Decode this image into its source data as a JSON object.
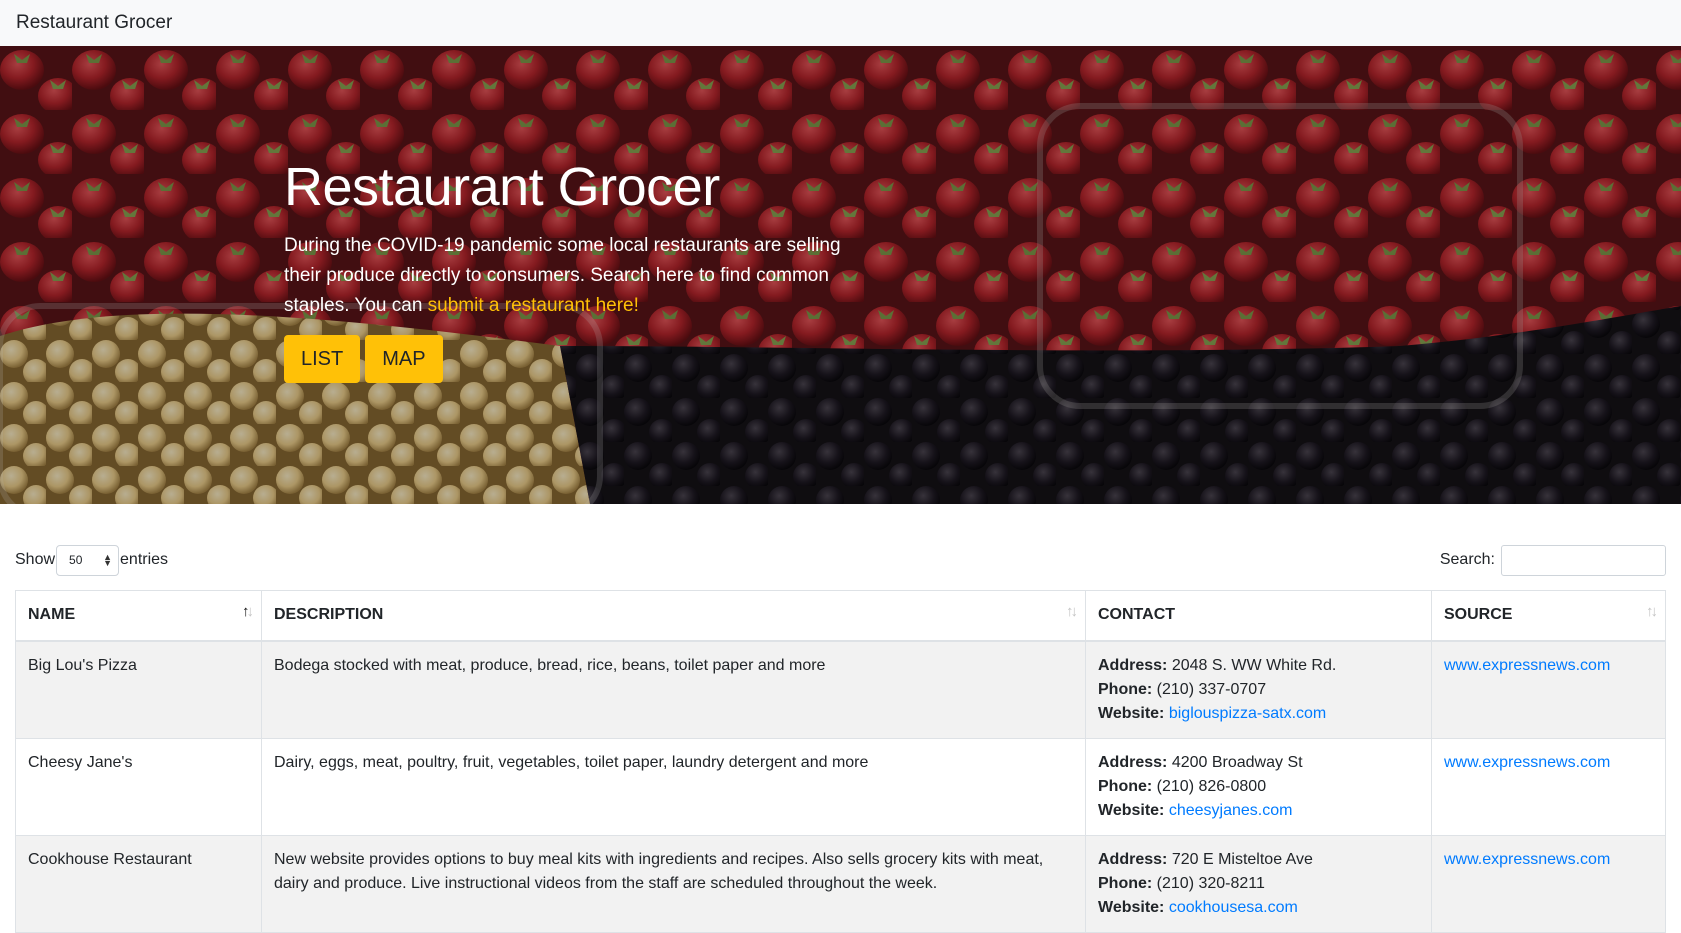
{
  "navbar": {
    "brand": "Restaurant Grocer"
  },
  "hero": {
    "title": "Restaurant Grocer",
    "text_before_link": "During the COVID-19 pandemic some local restaurants are selling their produce directly to consumers. Search here to find common staples. You can ",
    "link_text": "submit a restaurant here!",
    "buttons": {
      "list": "LIST",
      "map": "MAP"
    },
    "accent_color": "#ffc107"
  },
  "controls": {
    "show_label": "Show",
    "entries_label": "entries",
    "length_value": "50",
    "search_label": "Search:",
    "search_value": ""
  },
  "table": {
    "columns": [
      "NAME",
      "DESCRIPTION",
      "CONTACT",
      "SOURCE"
    ],
    "labels": {
      "address": "Address:",
      "phone": "Phone:",
      "website": "Website:"
    },
    "rows": [
      {
        "name": "Big Lou's Pizza",
        "description": "Bodega stocked with meat, produce, bread, rice, beans, toilet paper and more",
        "address": "2048 S. WW White Rd.",
        "phone": "(210) 337-0707",
        "website": "biglouspizza-satx.com",
        "source": "www.expressnews.com"
      },
      {
        "name": "Cheesy Jane's",
        "description": "Dairy, eggs, meat, poultry, fruit, vegetables, toilet paper, laundry detergent and more",
        "address": "4200 Broadway St",
        "phone": "(210) 826-0800",
        "website": "cheesyjanes.com",
        "source": "www.expressnews.com"
      },
      {
        "name": "Cookhouse Restaurant",
        "description": "New website provides options to buy meal kits with ingredients and recipes. Also sells grocery kits with meat, dairy and produce. Live instructional videos from the staff are scheduled throughout the week.",
        "address": "720 E Misteltoe Ave",
        "phone": "(210) 320-8211",
        "website": "cookhousesa.com",
        "source": "www.expressnews.com"
      }
    ]
  }
}
